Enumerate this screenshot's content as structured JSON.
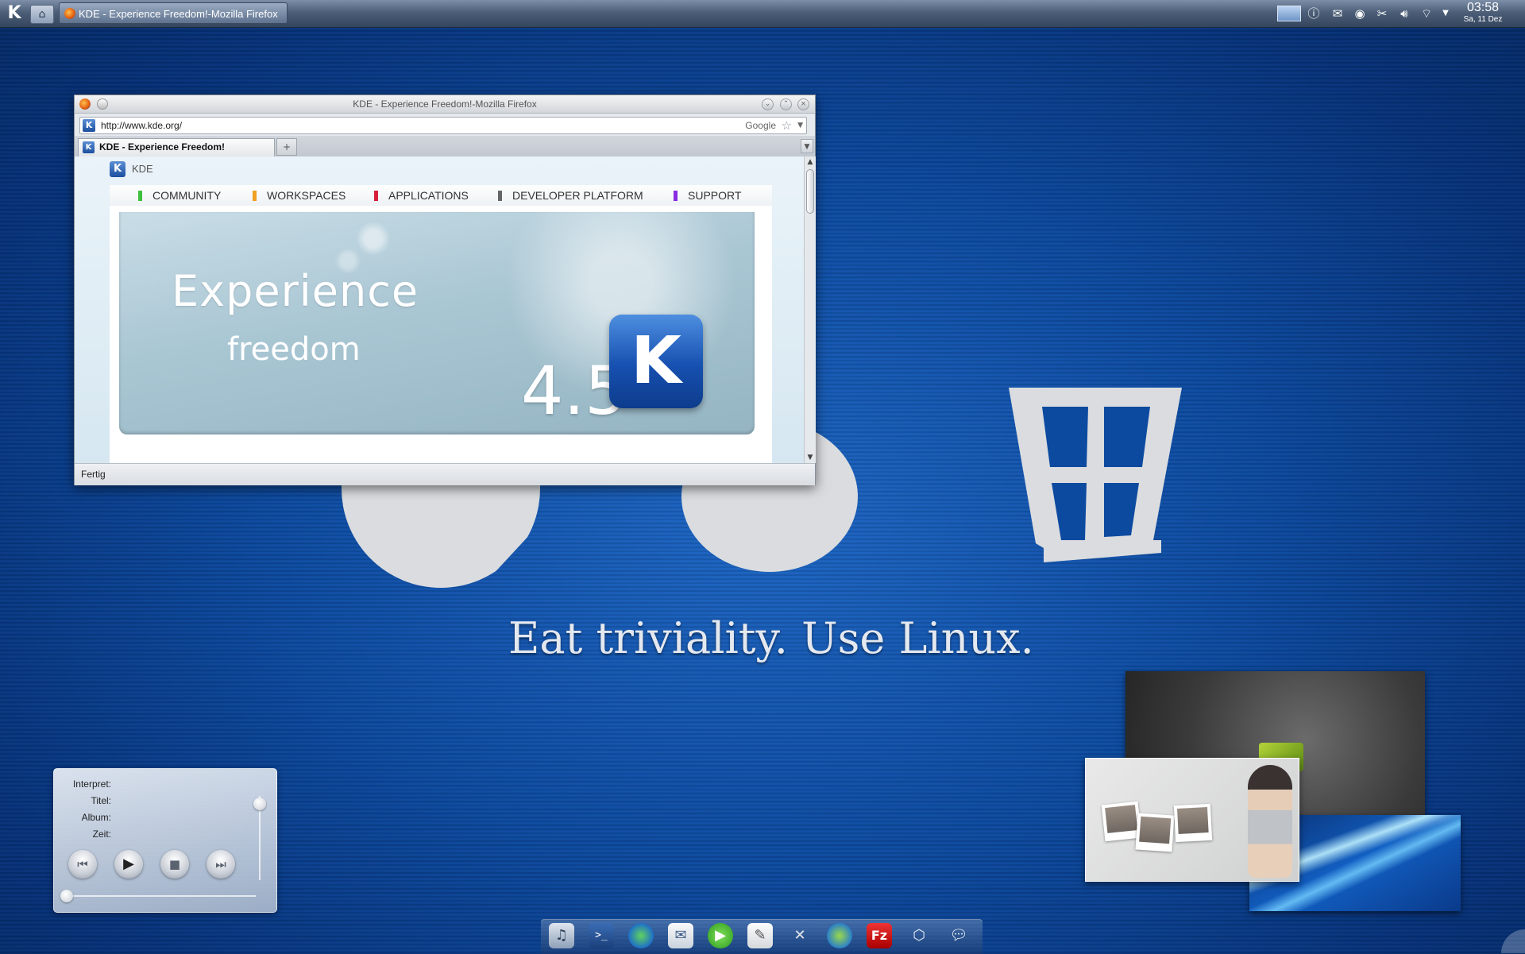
{
  "panel": {
    "taskbar_task": "KDE - Experience Freedom!-Mozilla Firefox",
    "clock_time": "03:58",
    "clock_date": "Sa, 11 Dez"
  },
  "browser": {
    "window_title": "KDE - Experience Freedom!-Mozilla Firefox",
    "url": "http://www.kde.org/",
    "search_engine": "Google",
    "tab_title": "KDE - Experience Freedom!",
    "status": "Fertig",
    "page": {
      "site_name": "KDE",
      "nav": [
        {
          "label": "COMMUNITY",
          "color": "#3fbf3f"
        },
        {
          "label": "WORKSPACES",
          "color": "#f0a020"
        },
        {
          "label": "APPLICATIONS",
          "color": "#d8203c"
        },
        {
          "label": "DEVELOPER PLATFORM",
          "color": "#666666"
        },
        {
          "label": "SUPPORT",
          "color": "#8a2be2"
        }
      ],
      "banner_line1": "Experience",
      "banner_line2": "freedom",
      "banner_version": "4.5"
    }
  },
  "desktop": {
    "slogan": "Eat triviality. Use Linux."
  },
  "media_player": {
    "labels": [
      "Interpret:",
      "Titel:",
      "Album:",
      "Zeit:"
    ]
  },
  "dock_icons": [
    "speaker-icon",
    "terminal-icon",
    "globe-icon",
    "mail-icon",
    "play-icon",
    "editor-icon",
    "tools-icon",
    "network-icon",
    "filezilla-icon",
    "package-icon",
    "chat-icon"
  ]
}
